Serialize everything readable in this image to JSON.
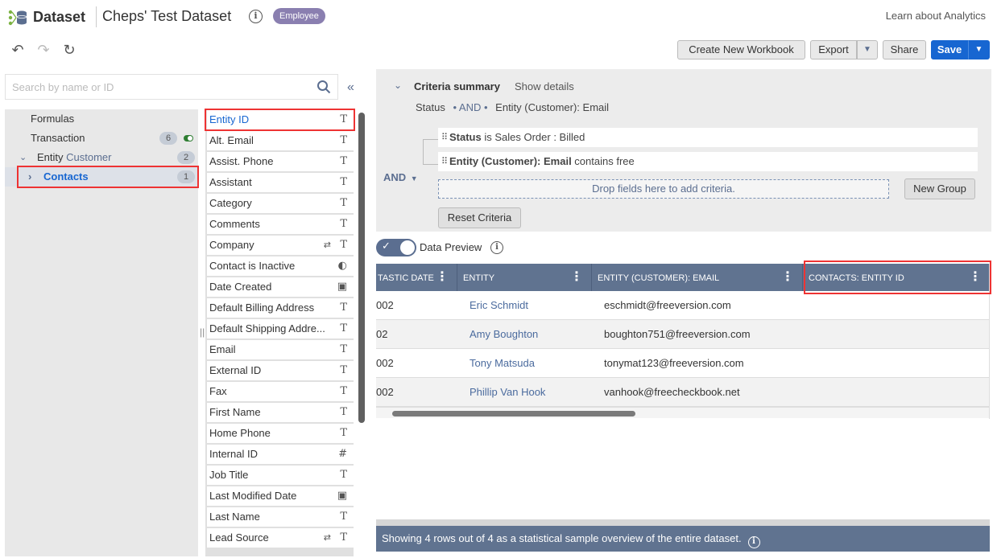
{
  "header": {
    "app_title": "Dataset",
    "dataset_name": "Cheps' Test Dataset",
    "role_badge": "Employee",
    "learn_link": "Learn about Analytics"
  },
  "toolbar": {
    "create_workbook": "Create New Workbook",
    "export": "Export",
    "share": "Share",
    "save": "Save"
  },
  "search": {
    "placeholder": "Search by name or ID"
  },
  "tree": {
    "items": [
      {
        "label": "Formulas"
      },
      {
        "label": "Transaction",
        "count": "6"
      },
      {
        "label": "Entity",
        "sublabel": "Customer",
        "count": "2"
      },
      {
        "label": "Contacts",
        "count": "1"
      }
    ]
  },
  "fields": [
    {
      "label": "Entity ID",
      "type": "T"
    },
    {
      "label": "Alt. Email",
      "type": "T"
    },
    {
      "label": "Assist. Phone",
      "type": "T"
    },
    {
      "label": "Assistant",
      "type": "T"
    },
    {
      "label": "Category",
      "type": "T"
    },
    {
      "label": "Comments",
      "type": "T"
    },
    {
      "label": "Company",
      "type": "T"
    },
    {
      "label": "Contact is Inactive",
      "type": ""
    },
    {
      "label": "Date Created",
      "type": ""
    },
    {
      "label": "Default Billing Address",
      "type": "T"
    },
    {
      "label": "Default Shipping Addre...",
      "type": "T"
    },
    {
      "label": "Email",
      "type": "T"
    },
    {
      "label": "External ID",
      "type": "T"
    },
    {
      "label": "Fax",
      "type": "T"
    },
    {
      "label": "First Name",
      "type": "T"
    },
    {
      "label": "Home Phone",
      "type": "T"
    },
    {
      "label": "Internal ID",
      "type": "#"
    },
    {
      "label": "Job Title",
      "type": "T"
    },
    {
      "label": "Last Modified Date",
      "type": ""
    },
    {
      "label": "Last Name",
      "type": "T"
    },
    {
      "label": "Lead Source",
      "type": "T"
    }
  ],
  "criteria": {
    "title": "Criteria summary",
    "show_details": "Show details",
    "summary_status": "Status",
    "summary_and": "• AND •",
    "summary_field": "Entity (Customer): Email",
    "row1_field": "Status",
    "row1_rest": " is Sales Order : Billed",
    "row2_field": "Entity (Customer): Email",
    "row2_rest": " contains free",
    "and_label": "AND",
    "drop_zone": "Drop fields here to add criteria.",
    "new_group": "New Group",
    "reset": "Reset Criteria"
  },
  "preview": {
    "label": "Data Preview"
  },
  "grid": {
    "headers": [
      "TASTIC DATE",
      "ENTITY",
      "ENTITY (CUSTOMER): EMAIL",
      "CONTACTS: ENTITY ID"
    ],
    "rows": [
      {
        "date": "002",
        "entity": "Eric Schmidt",
        "email": "eschmidt@freeversion.com",
        "contact": ""
      },
      {
        "date": "02",
        "entity": "Amy Boughton",
        "email": "boughton751@freeversion.com",
        "contact": ""
      },
      {
        "date": "002",
        "entity": "Tony Matsuda",
        "email": "tonymat123@freeversion.com",
        "contact": ""
      },
      {
        "date": "002",
        "entity": "Phillip Van Hook",
        "email": "vanhook@freecheckbook.net",
        "contact": ""
      }
    ]
  },
  "footer": {
    "text": "Showing 4 rows out of 4 as a statistical sample overview of the entire dataset."
  }
}
